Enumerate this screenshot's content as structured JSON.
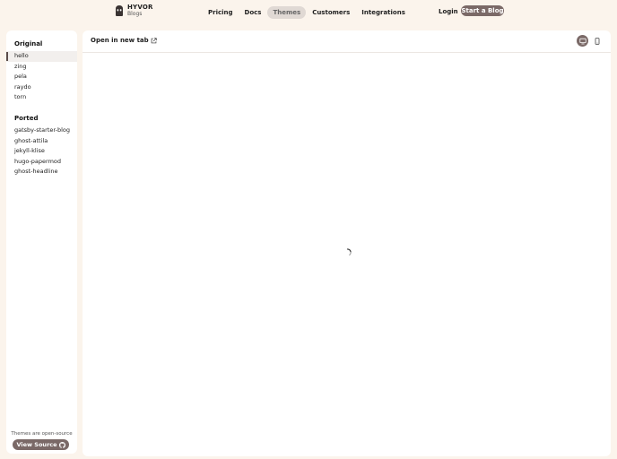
{
  "brand": {
    "name": "HYVOR",
    "product": "Blogs"
  },
  "nav": {
    "items": [
      {
        "label": "Pricing",
        "active": false
      },
      {
        "label": "Docs",
        "active": false
      },
      {
        "label": "Themes",
        "active": true
      },
      {
        "label": "Customers",
        "active": false
      },
      {
        "label": "Integrations",
        "active": false
      }
    ],
    "login_label": "Login",
    "cta_label": "Start a Blog"
  },
  "sidebar": {
    "original_heading": "Original",
    "original_items": [
      "hello",
      "zing",
      "pela",
      "raydo",
      "torn"
    ],
    "ported_heading": "Ported",
    "ported_items": [
      "gatsby-starter-blog",
      "ghost-attila",
      "jekyll-klise",
      "hugo-papermod",
      "ghost-headline"
    ],
    "selected": "hello",
    "footer_text": "Themes are open-source",
    "source_button_label": "View Source"
  },
  "preview": {
    "open_link_label": "Open in new tab",
    "device_selected": "desktop",
    "loading": true
  },
  "colors": {
    "background": "#fbf4ec",
    "accent": "#7a6967",
    "panel": "#ffffff"
  }
}
